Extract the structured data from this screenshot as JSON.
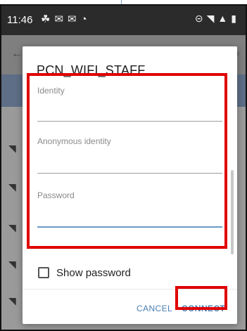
{
  "status_bar": {
    "time": "11:46",
    "notification_icons": [
      "notification-app-icon",
      "mail-icon",
      "mail-icon",
      "wifi-question-icon"
    ],
    "right_icons": [
      "do-not-disturb-icon",
      "wifi-icon",
      "lte-signal-icon",
      "battery-icon"
    ]
  },
  "dialog": {
    "title": "PCN_WIFI_STAFF",
    "fields": {
      "identity": {
        "label": "Identity",
        "value": ""
      },
      "anonymous_identity": {
        "label": "Anonymous identity",
        "value": ""
      },
      "password": {
        "label": "Password",
        "value": ""
      }
    },
    "show_password": {
      "label": "Show password",
      "checked": false
    },
    "buttons": {
      "cancel": "CANCEL",
      "connect": "CONNECT"
    }
  },
  "highlight_color": "#e00000",
  "accent_color": "#4b7fb4"
}
